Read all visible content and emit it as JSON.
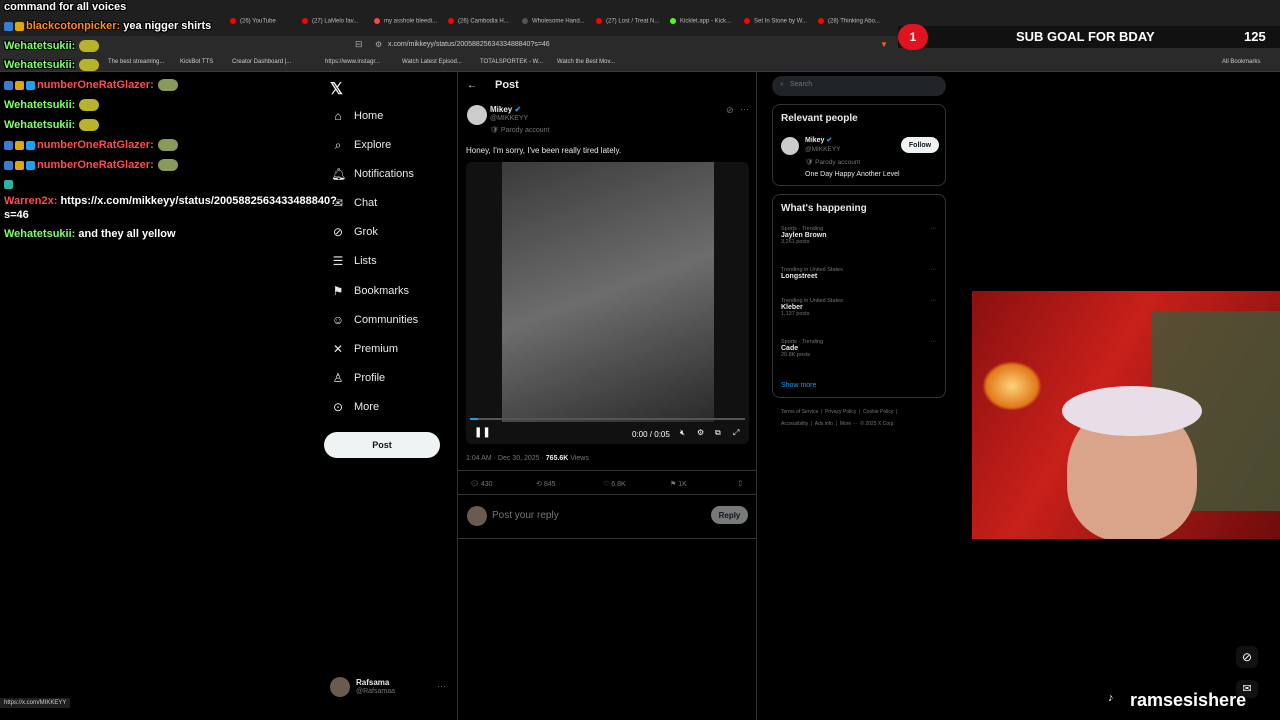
{
  "chat": {
    "header": "command for all voices",
    "messages": [
      {
        "user": "blackcotonpicker:",
        "text": "yea nigger shirts",
        "user_color": "#ff8c1a"
      },
      {
        "user": "Wehatetsukii:",
        "text": "",
        "user_color": "#7fff6a"
      },
      {
        "user": "Wehatetsukii:",
        "text": "",
        "user_color": "#7fff6a"
      },
      {
        "user": "numberOneRatGlazer:",
        "text": "",
        "user_color": "#ff4d4d"
      },
      {
        "user": "Wehatetsukii:",
        "text": "",
        "user_color": "#7fff6a"
      },
      {
        "user": "Wehatetsukii:",
        "text": "",
        "user_color": "#7fff6a"
      },
      {
        "user": "numberOneRatGlazer:",
        "text": "",
        "user_color": "#ff4d4d"
      },
      {
        "user": "numberOneRatGlazer:",
        "text": "",
        "user_color": "#ff4d4d"
      },
      {
        "user": "Warren2x:",
        "text": "https://x.com/mikkeyy/status/2005882563433488840?s=46",
        "user_color": "#ff4d4d"
      },
      {
        "user": "Wehatetsukii:",
        "text": "and they all yellow",
        "user_color": "#7fff6a"
      }
    ]
  },
  "browser": {
    "tabs": [
      "(26) YouTube",
      "(27) LaMelo fav...",
      "my asshole bleedi...",
      "(26) Cambodia H...",
      "Wholesome Hand...",
      "(27) Lost / Treat N...",
      "Kicklet.app - Kick...",
      "Set In Stone by W...",
      "(28) Thinking Abo..."
    ],
    "url": "x.com/mikkeyy/status/2005882563433488840?s=46",
    "bookmarks": [
      "The best streaming...",
      "KickBot TTS",
      "Creator Dashboard |...",
      "https://www.instagr...",
      "Watch Latest Episod...",
      "TOTALSPORTEK - W...",
      "Watch the Best Mov..."
    ],
    "all_bookmarks": "All Bookmarks",
    "status_url": "https://x.com/MIKKEYY"
  },
  "nav": {
    "items": [
      "Home",
      "Explore",
      "Notifications",
      "Chat",
      "Grok",
      "Lists",
      "Bookmarks",
      "Communities",
      "Premium",
      "Profile",
      "More"
    ],
    "post_button": "Post",
    "account_name": "Rafsama",
    "account_handle": "@Rafsamaa"
  },
  "post": {
    "header": "Post",
    "author_name": "Mikey",
    "author_handle": "@MIKKEYY",
    "parody_label": "Parody account",
    "text": "Honey, I'm sorry, I've been really tired lately.",
    "video_time": "0:00 / 0:05",
    "timestamp": "1:04 AM · Dec 30, 2025 ·",
    "views_count": "765.6K",
    "views_label": "Views",
    "replies": "430",
    "reposts": "845",
    "likes": "6.8K",
    "bookmarks": "1K",
    "reply_placeholder": "Post your reply",
    "reply_button": "Reply"
  },
  "right": {
    "search_placeholder": "Search",
    "relevant_title": "Relevant people",
    "person_name": "Mikey",
    "person_handle": "@MIKKEYY",
    "person_parody": "Parody account",
    "person_bio": "One Day Happy Another Level",
    "follow_label": "Follow",
    "happening_title": "What's happening",
    "trends": [
      {
        "context": "Sports · Trending",
        "title": "Jaylen Brown",
        "posts": "3,261 posts"
      },
      {
        "context": "Trending in United States",
        "title": "Longstreet",
        "posts": ""
      },
      {
        "context": "Trending in United States",
        "title": "Kleber",
        "posts": "1,137 posts"
      },
      {
        "context": "Sports · Trending",
        "title": "Cade",
        "posts": "20.8K posts"
      }
    ],
    "show_more": "Show more",
    "footer_row1": "Terms of Service  |  Privacy Policy  |  Cookie Policy  |",
    "footer_row2": "Accessibility  |  Ads info  |  More ···  © 2025 X Corp."
  },
  "overlay": {
    "sub_count": "1",
    "sub_goal": "SUB GOAL FOR BDAY",
    "sub_goal_number": "125",
    "streamer_handle": "ramsesishere"
  },
  "colors": {
    "accent": "#1d9bf0",
    "bg": "#000000",
    "sub_badge": "#e0141e"
  }
}
